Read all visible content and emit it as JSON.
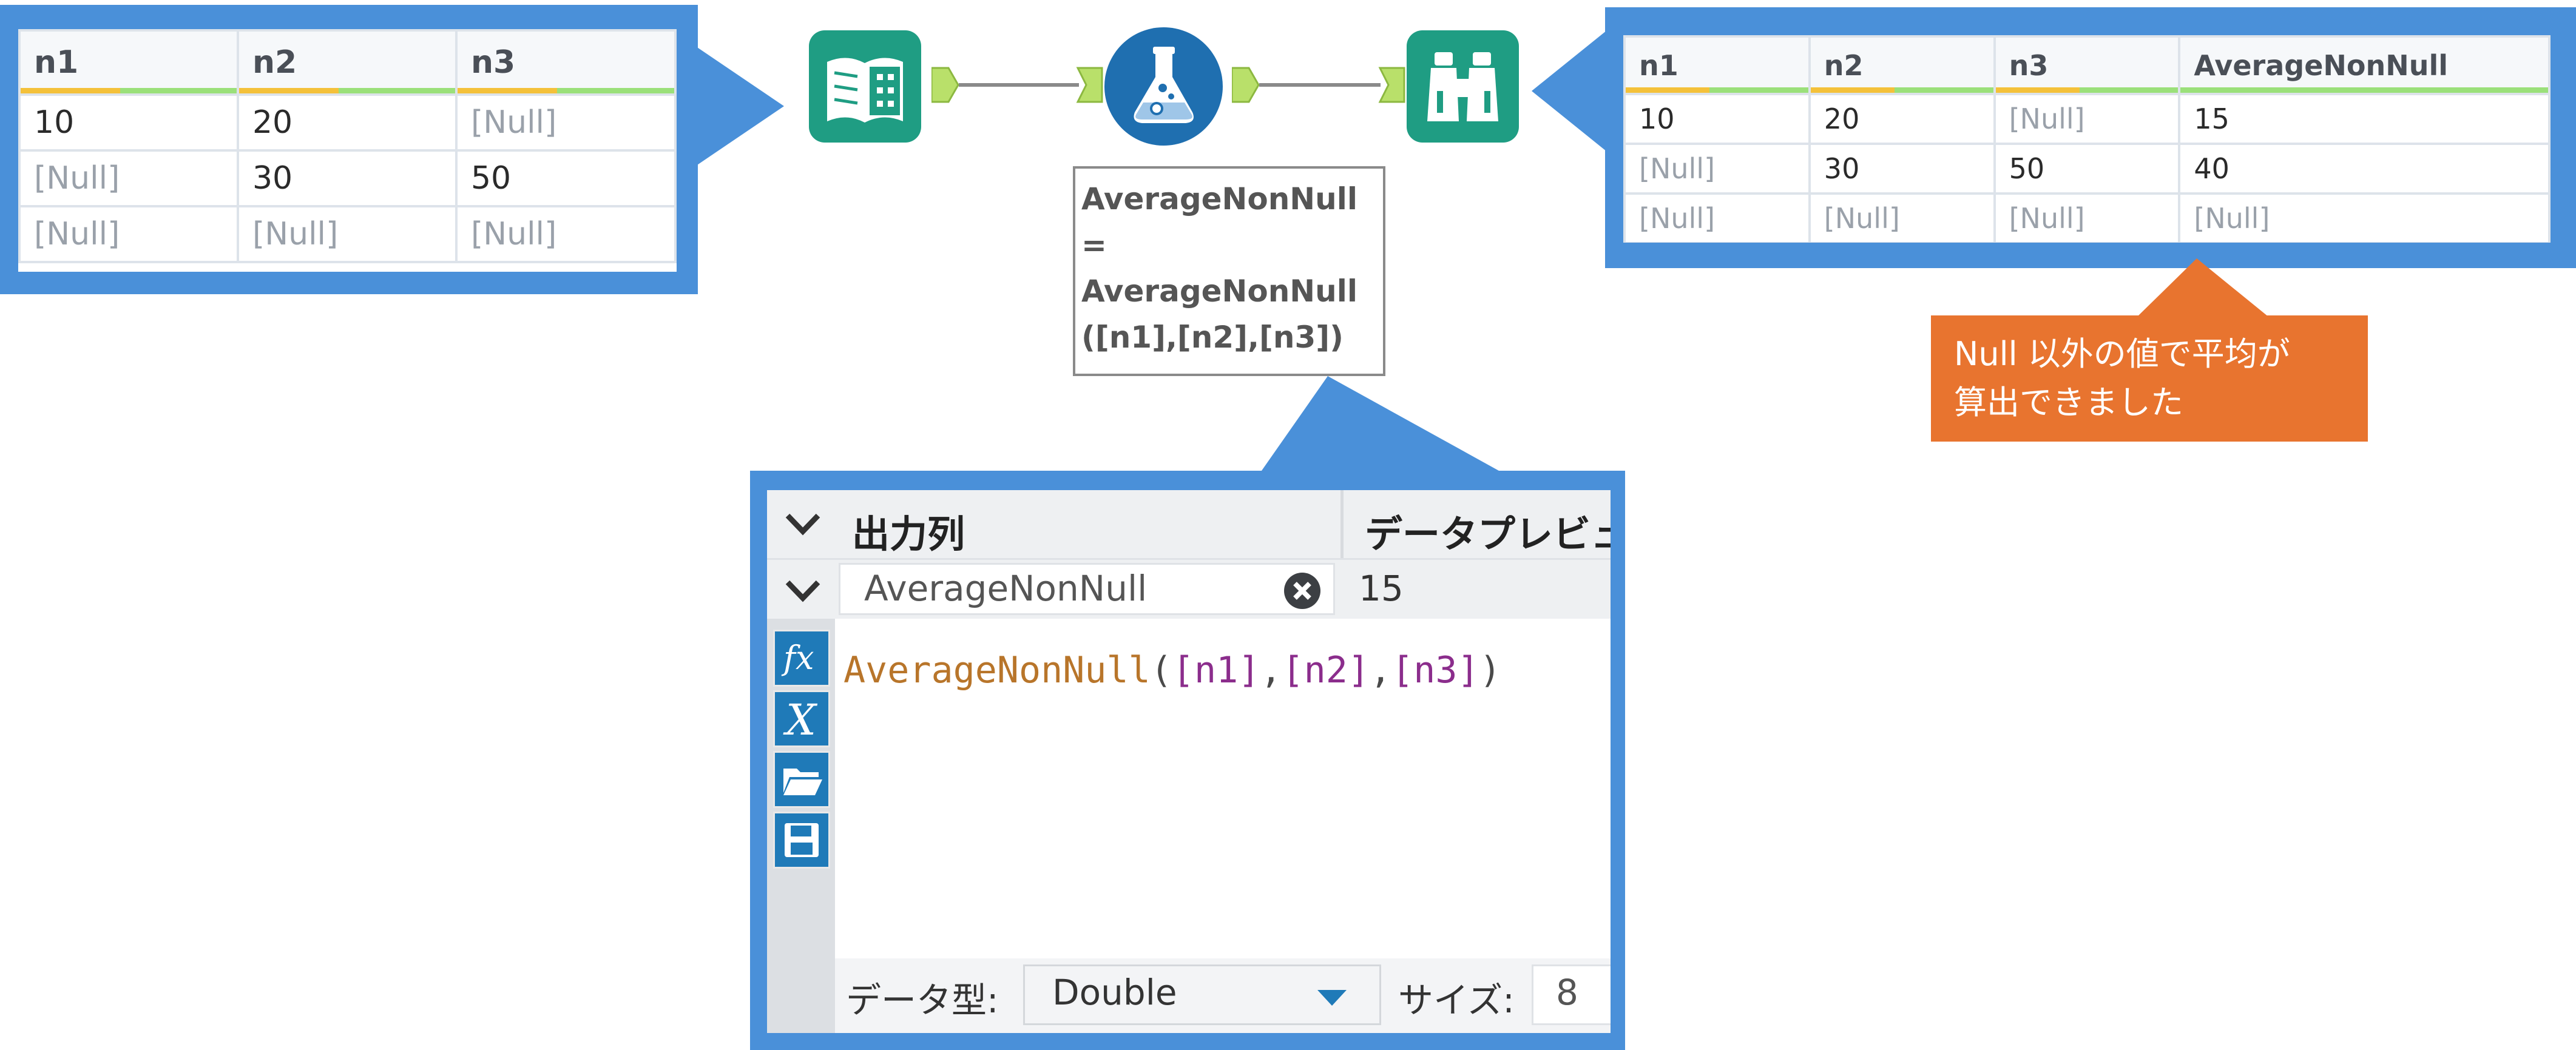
{
  "input_table": {
    "headers": [
      "n1",
      "n2",
      "n3"
    ],
    "rows": [
      [
        "10",
        "20",
        "[Null]"
      ],
      [
        "[Null]",
        "30",
        "50"
      ],
      [
        "[Null]",
        "[Null]",
        "[Null]"
      ]
    ]
  },
  "output_table": {
    "headers": [
      "n1",
      "n2",
      "n3",
      "AverageNonNull"
    ],
    "rows": [
      [
        "10",
        "20",
        "[Null]",
        "15"
      ],
      [
        "[Null]",
        "30",
        "50",
        "40"
      ],
      [
        "[Null]",
        "[Null]",
        "[Null]",
        "[Null]"
      ]
    ]
  },
  "workflow": {
    "tools": [
      {
        "name": "input-data-tool",
        "icon": "book-icon"
      },
      {
        "name": "formula-tool",
        "icon": "flask-icon"
      },
      {
        "name": "browse-tool",
        "icon": "binoculars-icon"
      }
    ],
    "annotation_lines": [
      "AverageNonNull",
      "=",
      "AverageNonNull",
      "([n1],[n2],[n3])"
    ]
  },
  "callout": {
    "lines": [
      "Null 以外の値で平均が",
      "算出できました"
    ]
  },
  "editor": {
    "header_output": "出力列",
    "header_preview": "データプレビュー",
    "field_name": "AverageNonNull",
    "preview_value": "15",
    "expression": {
      "fn": "AverageNonNull",
      "open": "(",
      "f1": "[n1]",
      "c1": ",",
      "f2": "[n2]",
      "c2": ",",
      "f3": "[n3]",
      "close": ")"
    },
    "datatype_label": "データ型:",
    "datatype_value": "Double",
    "size_label": "サイズ:",
    "size_value": "8",
    "side_icons": [
      "fx-icon",
      "variable-icon",
      "folder-open-icon",
      "save-icon"
    ]
  },
  "colors": {
    "frame_blue": "#4a90d9",
    "tool_green": "#1f9d83",
    "formula_blue": "#1f6fb0",
    "callout_orange": "#e8742f"
  }
}
